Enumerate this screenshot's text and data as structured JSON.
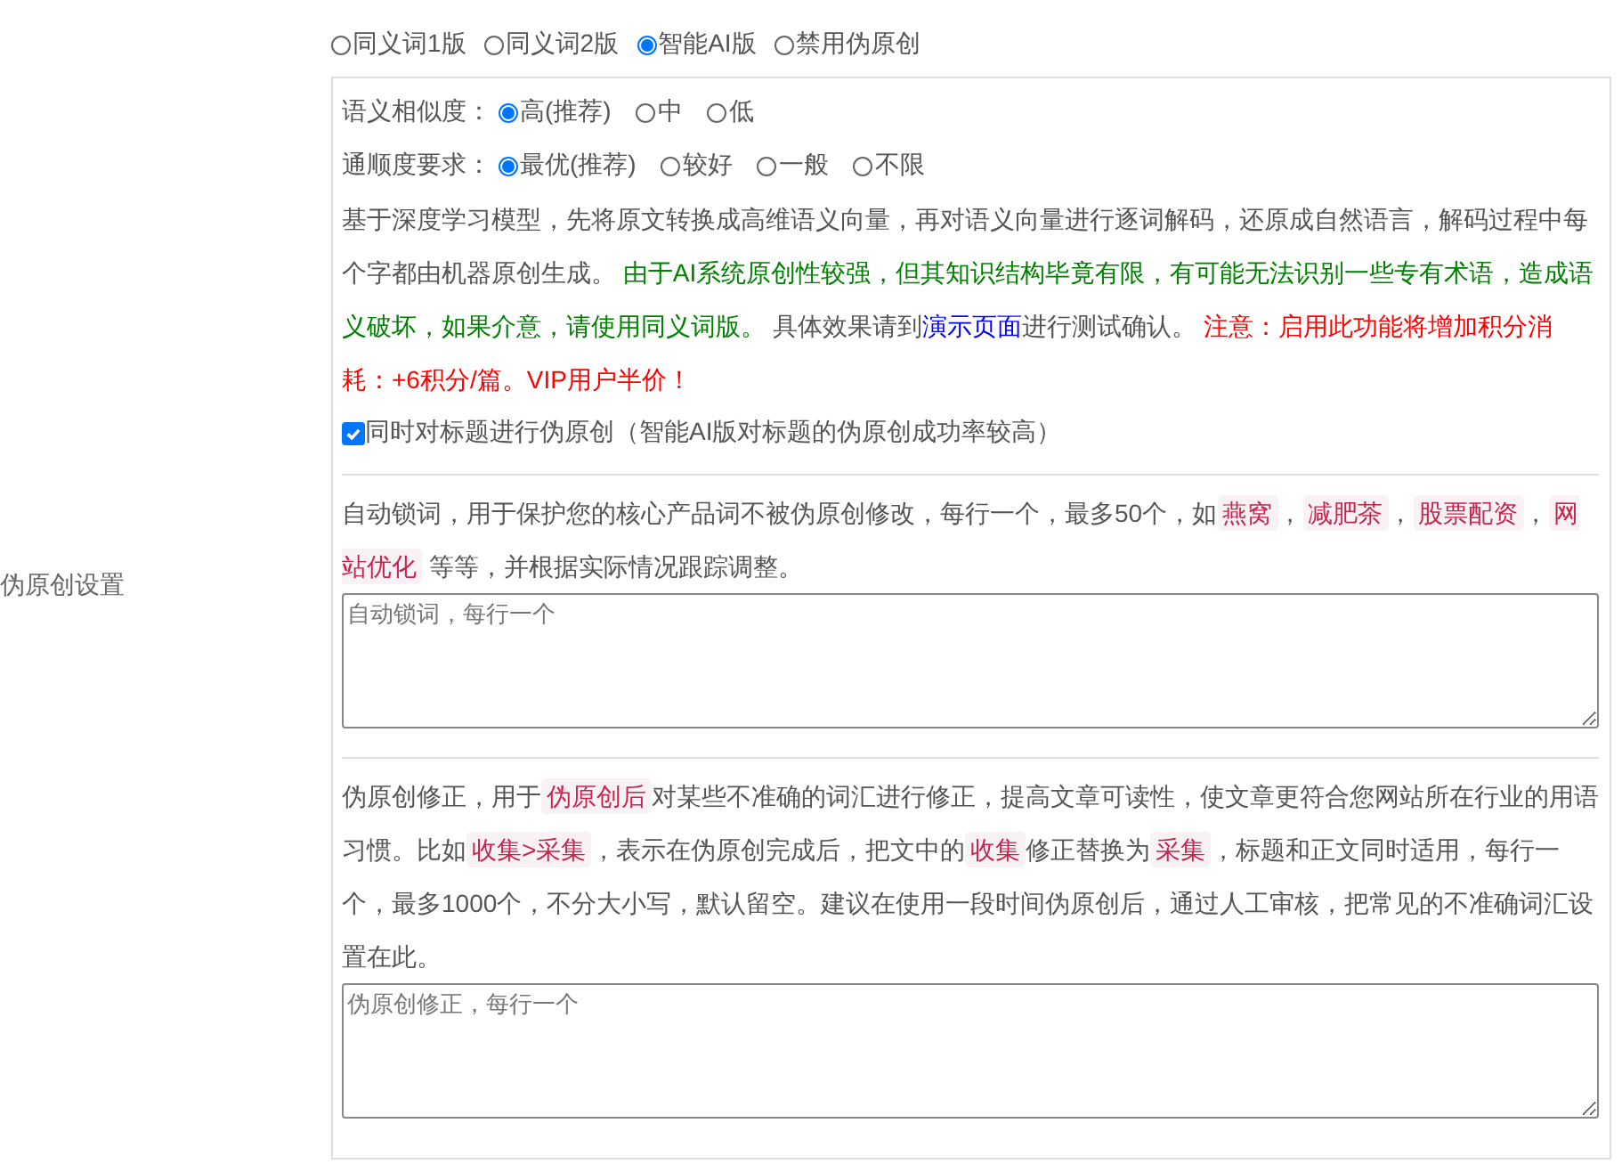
{
  "section_label": "伪原创设置",
  "modes": [
    {
      "label": "同义词1版",
      "selected": false
    },
    {
      "label": "同义词2版",
      "selected": false
    },
    {
      "label": "智能AI版",
      "selected": true
    },
    {
      "label": "禁用伪原创",
      "selected": false
    }
  ],
  "option_groups": [
    {
      "label": "语义相似度：",
      "options": [
        {
          "label": "高(推荐)",
          "selected": true
        },
        {
          "label": "中",
          "selected": false
        },
        {
          "label": "低",
          "selected": false
        }
      ]
    },
    {
      "label": "通顺度要求：",
      "options": [
        {
          "label": "最优(推荐)",
          "selected": true
        },
        {
          "label": "较好",
          "selected": false
        },
        {
          "label": "一般",
          "selected": false
        },
        {
          "label": "不限",
          "selected": false
        }
      ]
    }
  ],
  "ai_description": [
    {
      "kind": "plain",
      "text": "基于深度学习模型，先将原文转换成高维语义向量，再对语义向量进行逐词解码，还原成自然语言，解码过程中每个字都由机器原创生成。 "
    },
    {
      "kind": "green",
      "text": "由于AI系统原创性较强，但其知识结构毕竟有限，有可能无法识别一些专有术语，造成语义破坏，如果介意，请使用同义词版。"
    },
    {
      "kind": "plain",
      "text": " 具体效果请到"
    },
    {
      "kind": "link",
      "text": "演示页面"
    },
    {
      "kind": "plain",
      "text": "进行测试确认。 "
    },
    {
      "kind": "red",
      "text": "注意：启用此功能将增加积分消耗：+6积分/篇。VIP用户半价！"
    }
  ],
  "title_option": {
    "label": "同时对标题进行伪原创（智能AI版对标题的伪原创成功率较高）",
    "checked": true
  },
  "lock_words": {
    "description": [
      {
        "kind": "plain",
        "text": "自动锁词，用于保护您的核心产品词不被伪原创修改，每行一个，最多50个，如"
      },
      {
        "kind": "code",
        "text": "燕窝"
      },
      {
        "kind": "plain",
        "text": "，"
      },
      {
        "kind": "code",
        "text": "减肥茶"
      },
      {
        "kind": "plain",
        "text": "，"
      },
      {
        "kind": "code",
        "text": "股票配资"
      },
      {
        "kind": "plain",
        "text": "，"
      },
      {
        "kind": "code",
        "text": "网站优化"
      },
      {
        "kind": "plain",
        "text": " 等等，并根据实际情况跟踪调整。"
      }
    ],
    "placeholder": "自动锁词，每行一个"
  },
  "corrections": {
    "description": [
      {
        "kind": "plain",
        "text": "伪原创修正，用于"
      },
      {
        "kind": "code",
        "text": "伪原创后"
      },
      {
        "kind": "plain",
        "text": "对某些不准确的词汇进行修正，提高文章可读性，使文章更符合您网站所在行业的用语习惯。比如"
      },
      {
        "kind": "code",
        "text": "收集>采集"
      },
      {
        "kind": "plain",
        "text": "，表示在伪原创完成后，把文中的"
      },
      {
        "kind": "code",
        "text": "收集"
      },
      {
        "kind": "plain",
        "text": "修正替换为"
      },
      {
        "kind": "code",
        "text": "采集"
      },
      {
        "kind": "plain",
        "text": "，标题和正文同时适用，每行一个，最多1000个，不分大小写，默认留空。建议在使用一段时间伪原创后，通过人工审核，把常见的不准确词汇设置在此。"
      }
    ],
    "placeholder": "伪原创修正，每行一个"
  }
}
